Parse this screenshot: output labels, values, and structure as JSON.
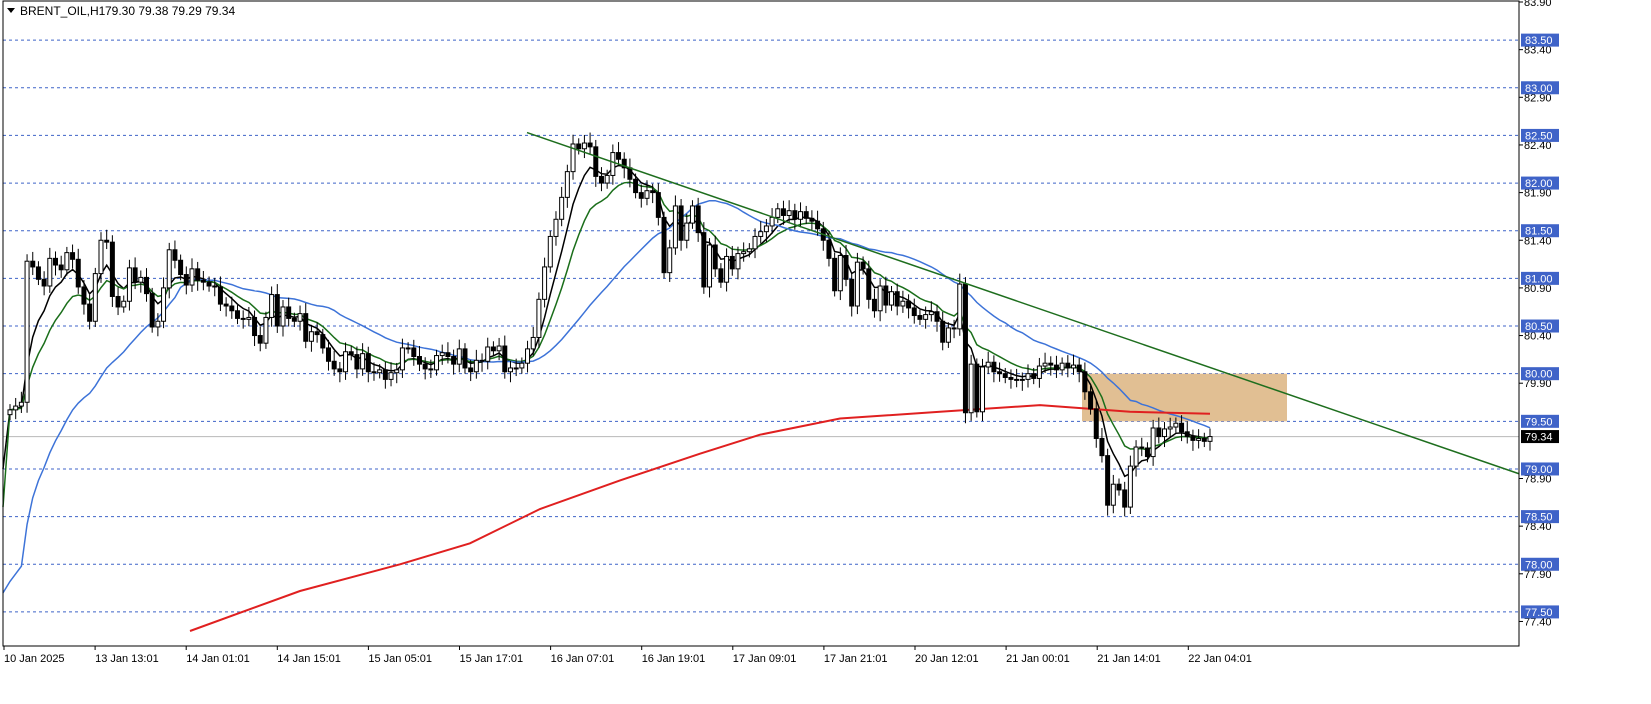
{
  "header": {
    "symbol_text": "BRENT_OIL,H1",
    "ohlc_text": "79.30 79.38 79.29 79.34"
  },
  "chart_data": {
    "type": "candlestick",
    "title": "BRENT_OIL,H1",
    "current_price": 79.34,
    "y_axis": {
      "min": 77.3,
      "max": 83.9,
      "tick_labels": [
        "83.90",
        "83.40",
        "82.90",
        "82.40",
        "81.90",
        "81.40",
        "80.90",
        "80.40",
        "79.90",
        "78.90",
        "78.40",
        "77.90",
        "77.40"
      ],
      "highlighted_levels": [
        "83.50",
        "83.00",
        "82.50",
        "82.00",
        "81.50",
        "81.00",
        "80.50",
        "80.00",
        "79.50",
        "79.00",
        "78.50",
        "78.00",
        "77.50"
      ]
    },
    "x_axis": {
      "labels": [
        "10 Jan 2025",
        "13 Jan 13:01",
        "14 Jan 01:01",
        "14 Jan 15:01",
        "15 Jan 05:01",
        "15 Jan 17:01",
        "16 Jan 07:01",
        "16 Jan 19:01",
        "17 Jan 09:01",
        "17 Jan 21:01",
        "20 Jan 12:01",
        "21 Jan 00:01",
        "21 Jan 14:01",
        "22 Jan 04:01"
      ]
    },
    "horizontal_levels": [
      83.5,
      83.0,
      82.5,
      82.0,
      81.5,
      81.0,
      80.5,
      80.0,
      79.5,
      79.0,
      78.5,
      78.0,
      77.5
    ],
    "candles": [
      79.62,
      79.66,
      79.7,
      81.18,
      81.12,
      80.99,
      80.92,
      81.21,
      81.14,
      81.09,
      81.27,
      81.2,
      80.91,
      80.73,
      80.55,
      81.05,
      81.4,
      81.38,
      80.81,
      80.7,
      80.76,
      81.11,
      80.96,
      81.01,
      80.84,
      80.49,
      80.55,
      80.9,
      81.3,
      81.19,
      81.04,
      80.93,
      81.1,
      80.98,
      80.96,
      80.92,
      80.91,
      80.73,
      80.71,
      80.66,
      80.58,
      80.57,
      80.59,
      80.4,
      80.32,
      80.59,
      80.83,
      80.5,
      80.7,
      80.58,
      80.55,
      80.63,
      80.34,
      80.44,
      80.41,
      80.27,
      80.13,
      80.05,
      80.02,
      80.23,
      80.2,
      80.05,
      80.21,
      80.02,
      80.01,
      80.04,
      79.94,
      80.01,
      80.04,
      80.27,
      80.27,
      80.18,
      80.1,
      80.05,
      80.04,
      80.19,
      80.22,
      80.18,
      80.1,
      80.26,
      80.06,
      80.02,
      80.14,
      80.13,
      80.28,
      80.24,
      80.29,
      80.02,
      80.06,
      80.06,
      80.11,
      80.26,
      80.38,
      80.78,
      81.12,
      81.44,
      81.62,
      81.85,
      82.12,
      82.41,
      82.36,
      82.42,
      82.38,
      82.07,
      82.0,
      82.08,
      82.32,
      82.25,
      82.16,
      82.04,
      81.9,
      81.84,
      81.92,
      81.9,
      81.64,
      81.06,
      81.32,
      81.76,
      81.4,
      81.58,
      81.76,
      81.48,
      80.91,
      81.35,
      81.1,
      80.96,
      81.23,
      81.1,
      81.26,
      81.28,
      81.31,
      81.44,
      81.49,
      81.55,
      81.64,
      81.73,
      81.66,
      81.71,
      81.62,
      81.7,
      81.63,
      81.6,
      81.52,
      81.4,
      81.21,
      80.87,
      81.24,
      80.99,
      80.71,
      81.17,
      81.1,
      80.78,
      80.66,
      80.92,
      80.72,
      80.86,
      80.71,
      80.76,
      80.69,
      80.61,
      80.57,
      80.62,
      80.65,
      80.55,
      80.33,
      80.48,
      80.47,
      80.94,
      79.59,
      80.1,
      79.6,
      80.07,
      80.12,
      80.02,
      80.0,
      79.96,
      79.94,
      79.93,
      79.94,
      80.0,
      79.95,
      80.08,
      80.11,
      80.09,
      80.04,
      80.11,
      80.06,
      80.09,
      80.02,
      79.81,
      79.63,
      79.32,
      79.14,
      78.62,
      78.84,
      78.78,
      78.6,
      79.03,
      79.23,
      79.22,
      79.13,
      79.43,
      79.34,
      79.42,
      79.44,
      79.48,
      79.39,
      79.34,
      79.3,
      79.32,
      79.29,
      79.34
    ]
  }
}
